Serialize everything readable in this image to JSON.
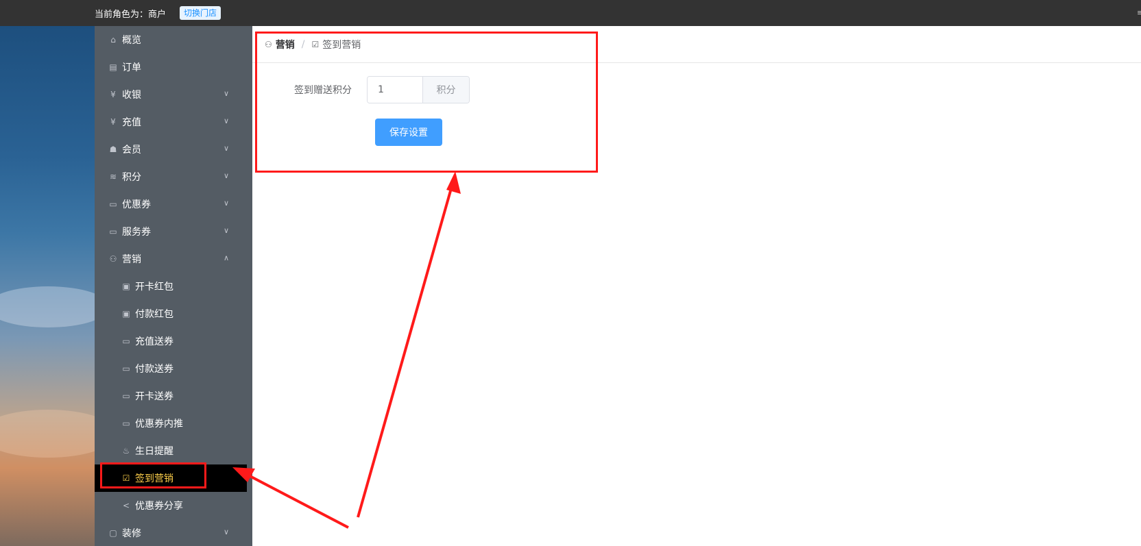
{
  "topbar": {
    "role_text": "当前角色为：商户",
    "switch_label": "切换门店"
  },
  "sidebar": {
    "items": [
      {
        "label": "概览",
        "icon": "home-icon"
      },
      {
        "label": "订单",
        "icon": "order-icon"
      },
      {
        "label": "收银",
        "icon": "cashier-icon",
        "expandable": true
      },
      {
        "label": "充值",
        "icon": "recharge-icon",
        "expandable": true
      },
      {
        "label": "会员",
        "icon": "member-icon",
        "expandable": true
      },
      {
        "label": "积分",
        "icon": "points-icon",
        "expandable": true
      },
      {
        "label": "优惠券",
        "icon": "coupon-icon",
        "expandable": true
      },
      {
        "label": "服务券",
        "icon": "service-coupon-icon",
        "expandable": true
      },
      {
        "label": "营销",
        "icon": "marketing-icon",
        "expandable": true,
        "expanded": true
      },
      {
        "label": "开卡红包",
        "icon": "red-packet-icon",
        "sub": true
      },
      {
        "label": "付款红包",
        "icon": "red-packet-icon",
        "sub": true
      },
      {
        "label": "充值送券",
        "icon": "coupon-icon",
        "sub": true
      },
      {
        "label": "付款送券",
        "icon": "coupon-icon",
        "sub": true
      },
      {
        "label": "开卡送券",
        "icon": "coupon-icon",
        "sub": true
      },
      {
        "label": "优惠券内推",
        "icon": "coupon-icon",
        "sub": true
      },
      {
        "label": "生日提醒",
        "icon": "cake-icon",
        "sub": true
      },
      {
        "label": "签到营销",
        "icon": "checkin-icon",
        "sub": true,
        "active": true
      },
      {
        "label": "优惠券分享",
        "icon": "share-icon",
        "sub": true
      },
      {
        "label": "装修",
        "icon": "decorate-icon",
        "expandable": true
      }
    ],
    "active_color": "#ffd04b",
    "bg_color": "#545c64"
  },
  "breadcrumb": {
    "parent": "营销",
    "current": "签到营销",
    "separator": "/"
  },
  "form": {
    "label": "签到赠送积分",
    "value": "1",
    "append": "积分",
    "save_label": "保存设置"
  },
  "colors": {
    "primary": "#409eff",
    "highlight": "#ff1a1a"
  }
}
